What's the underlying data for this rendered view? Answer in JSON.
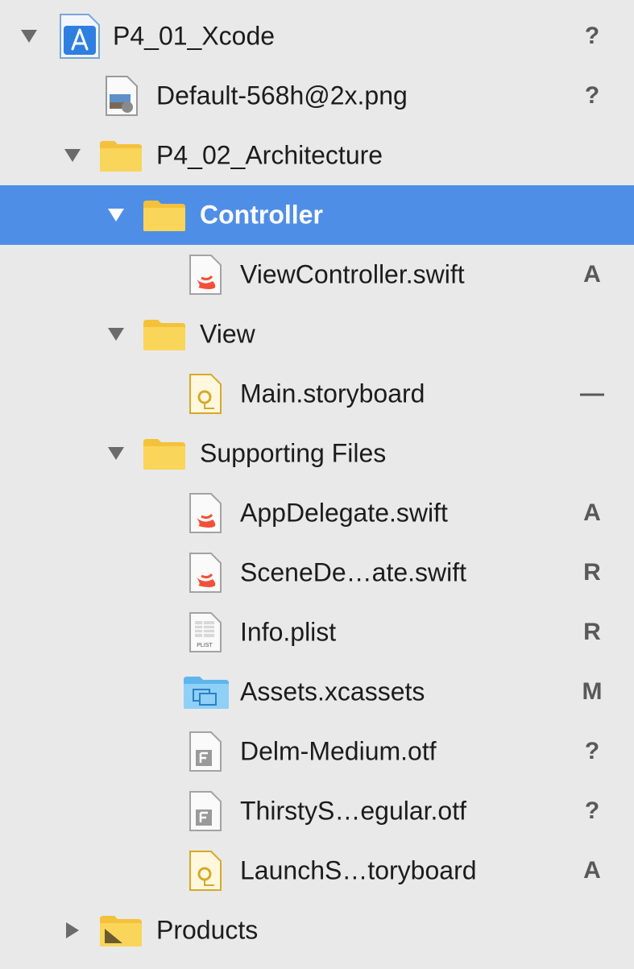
{
  "items": [
    {
      "label": "P4_01_Xcode",
      "status": "?",
      "icon": "xcode-project-icon"
    },
    {
      "label": "Default-568h@2x.png",
      "status": "?",
      "icon": "image-file-icon"
    },
    {
      "label": "P4_02_Architecture",
      "status": "",
      "icon": "folder-icon"
    },
    {
      "label": "Controller",
      "status": "",
      "icon": "folder-icon",
      "selected": true
    },
    {
      "label": "ViewController.swift",
      "status": "A",
      "icon": "swift-file-icon"
    },
    {
      "label": "View",
      "status": "",
      "icon": "folder-icon"
    },
    {
      "label": "Main.storyboard",
      "status": "—",
      "icon": "storyboard-file-icon"
    },
    {
      "label": "Supporting Files",
      "status": "",
      "icon": "folder-icon"
    },
    {
      "label": "AppDelegate.swift",
      "status": "A",
      "icon": "swift-file-icon"
    },
    {
      "label": "SceneDe…ate.swift",
      "status": "R",
      "icon": "swift-file-icon"
    },
    {
      "label": "Info.plist",
      "status": "R",
      "icon": "plist-file-icon"
    },
    {
      "label": "Assets.xcassets",
      "status": "M",
      "icon": "asset-catalog-icon"
    },
    {
      "label": "Delm-Medium.otf",
      "status": "?",
      "icon": "font-file-icon"
    },
    {
      "label": "ThirstyS…egular.otf",
      "status": "?",
      "icon": "font-file-icon"
    },
    {
      "label": "LaunchS…toryboard",
      "status": "A",
      "icon": "storyboard-file-icon"
    },
    {
      "label": "Products",
      "status": "",
      "icon": "products-folder-icon"
    }
  ],
  "plist_icon_text": "PLIST",
  "colors": {
    "background": "#e9e9e9",
    "selection": "#4f8ee6",
    "folder": "#f7c93e",
    "swift": "#f05138"
  }
}
